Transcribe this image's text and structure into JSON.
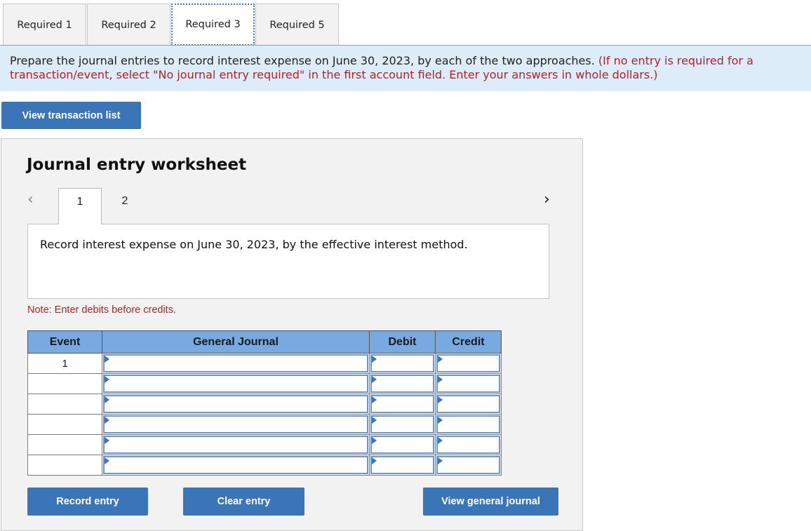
{
  "tabs": [
    {
      "label": "Required 1",
      "active": false
    },
    {
      "label": "Required 2",
      "active": false
    },
    {
      "label": "Required 3",
      "active": true
    },
    {
      "label": "Required 5",
      "active": false
    }
  ],
  "instructions": {
    "main": "Prepare the journal entries to record interest expense on June 30, 2023, by each of the two approaches. ",
    "note": "(If no entry is required for a transaction/event, select \"No journal entry required\" in the first account field. Enter your answers in whole dollars.)"
  },
  "view_transaction_list_label": "View transaction list",
  "worksheet": {
    "title": "Journal entry worksheet",
    "prev_icon": "‹",
    "next_icon": "›",
    "subtabs": [
      "1",
      "2"
    ],
    "description": "Record interest expense on June 30, 2023, by the effective interest method.",
    "note": "Note: Enter debits before credits.",
    "table": {
      "headers": [
        "Event",
        "General Journal",
        "Debit",
        "Credit"
      ],
      "rows": [
        {
          "event": "1",
          "account": "",
          "debit": "",
          "credit": ""
        },
        {
          "event": "",
          "account": "",
          "debit": "",
          "credit": ""
        },
        {
          "event": "",
          "account": "",
          "debit": "",
          "credit": ""
        },
        {
          "event": "",
          "account": "",
          "debit": "",
          "credit": ""
        },
        {
          "event": "",
          "account": "",
          "debit": "",
          "credit": ""
        },
        {
          "event": "",
          "account": "",
          "debit": "",
          "credit": ""
        }
      ]
    },
    "buttons": {
      "record": "Record entry",
      "clear": "Clear entry",
      "view_general_journal": "View general journal"
    }
  },
  "colors": {
    "accent_button": "#3a75b8",
    "header_blue": "#78a9e0",
    "instruction_bg": "#dcecf8",
    "note_red": "#b3202a"
  }
}
